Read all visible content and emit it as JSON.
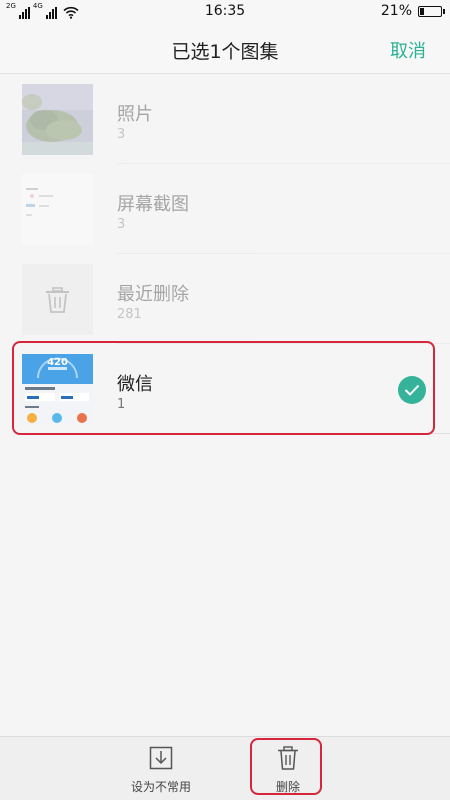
{
  "status_bar": {
    "network_1": "2G",
    "network_2": "4G",
    "time": "16:35",
    "battery_percent_text": "21%",
    "battery_level": 0.21,
    "wifi_icon": "wifi-icon",
    "signal_icon": "signal-icon"
  },
  "header": {
    "title": "已选1个图集",
    "cancel_label": "取消"
  },
  "albums": [
    {
      "name": "照片",
      "count": "3",
      "selected": false
    },
    {
      "name": "屏幕截图",
      "count": "3",
      "selected": false
    },
    {
      "name": "最近删除",
      "count": "281",
      "selected": false
    },
    {
      "name": "微信",
      "count": "1",
      "selected": true
    }
  ],
  "wechat_thumb": {
    "score": "420"
  },
  "toolbar": {
    "set_uncommon_label": "设为不常用",
    "delete_label": "删除"
  },
  "colors": {
    "accent": "#2bb296",
    "check": "#35b39a",
    "highlight_outline": "#d6263b"
  }
}
